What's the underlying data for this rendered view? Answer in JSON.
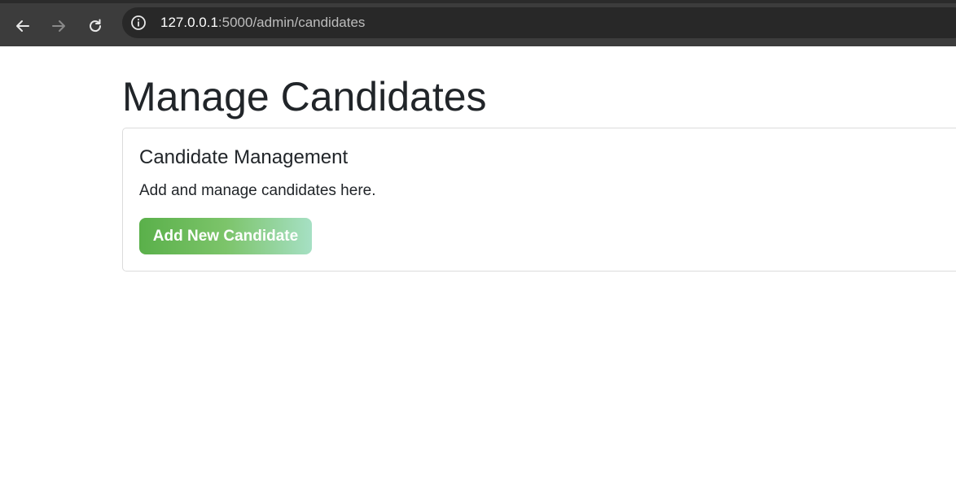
{
  "browser": {
    "url_host": "127.0.0.1",
    "url_rest": ":5000/admin/candidates",
    "icons": {
      "back": "back-arrow-icon",
      "forward": "forward-arrow-icon",
      "reload": "reload-icon",
      "info": "info-icon"
    }
  },
  "page": {
    "title": "Manage Candidates"
  },
  "card": {
    "title": "Candidate Management",
    "description": "Add and manage candidates here.",
    "add_button_label": "Add New Candidate"
  },
  "colors": {
    "button_gradient_start": "#5ab04a",
    "button_gradient_end": "#a6e0c4",
    "text": "#212529",
    "browser_chrome": "#3c3c3c"
  }
}
